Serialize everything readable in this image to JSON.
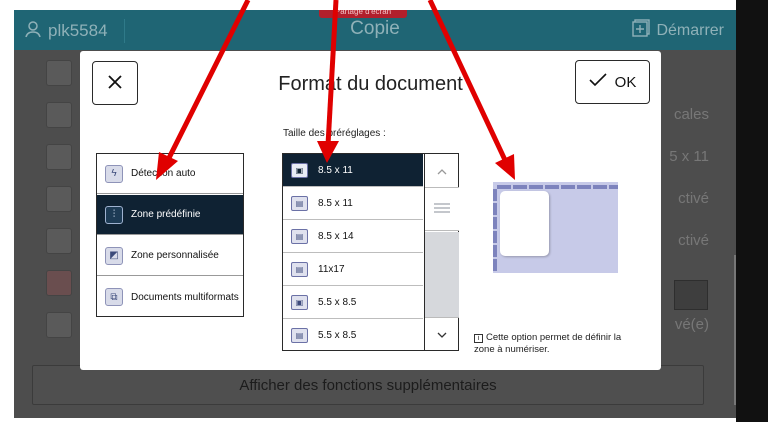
{
  "header": {
    "user": "plk5584",
    "title": "Copie",
    "badge": "Partage d'écran",
    "start": "Démarrer"
  },
  "underlay": {
    "row_values": [
      "",
      "cales",
      "5 x 11",
      "ctivé",
      "ctivé",
      "",
      "vé(e)"
    ],
    "more_button": "Afficher des fonctions supplémentaires"
  },
  "dialog": {
    "title": "Format du document",
    "ok_label": "OK",
    "close_icon": "close-icon",
    "modes": [
      {
        "label": "Détection auto",
        "icon": "auto-detect-icon",
        "selected": false
      },
      {
        "label": "Zone prédéfinie",
        "icon": "preset-sliders-icon",
        "selected": true
      },
      {
        "label": "Zone personnalisée",
        "icon": "custom-area-icon",
        "selected": false
      },
      {
        "label": "Documents multiformats",
        "icon": "multi-format-icon",
        "selected": false
      }
    ],
    "presets_label": "Taille des préréglages :",
    "presets": [
      {
        "label": "8.5 x 11",
        "orientation": "portrait",
        "selected": true
      },
      {
        "label": "8.5 x 11",
        "orientation": "landscape",
        "selected": false
      },
      {
        "label": "8.5 x 14",
        "orientation": "landscape",
        "selected": false
      },
      {
        "label": "11x17",
        "orientation": "landscape",
        "selected": false
      },
      {
        "label": "5.5 x 8.5",
        "orientation": "portrait",
        "selected": false
      },
      {
        "label": "5.5 x 8.5",
        "orientation": "landscape",
        "selected": false
      }
    ],
    "info_text": "Cette option permet de définir la zone à numériser."
  },
  "colors": {
    "header_bg": "#1f6574",
    "selected_bg": "#0f2233",
    "preview_bg": "#c7cae8",
    "annotation_arrow": "#e00000"
  }
}
